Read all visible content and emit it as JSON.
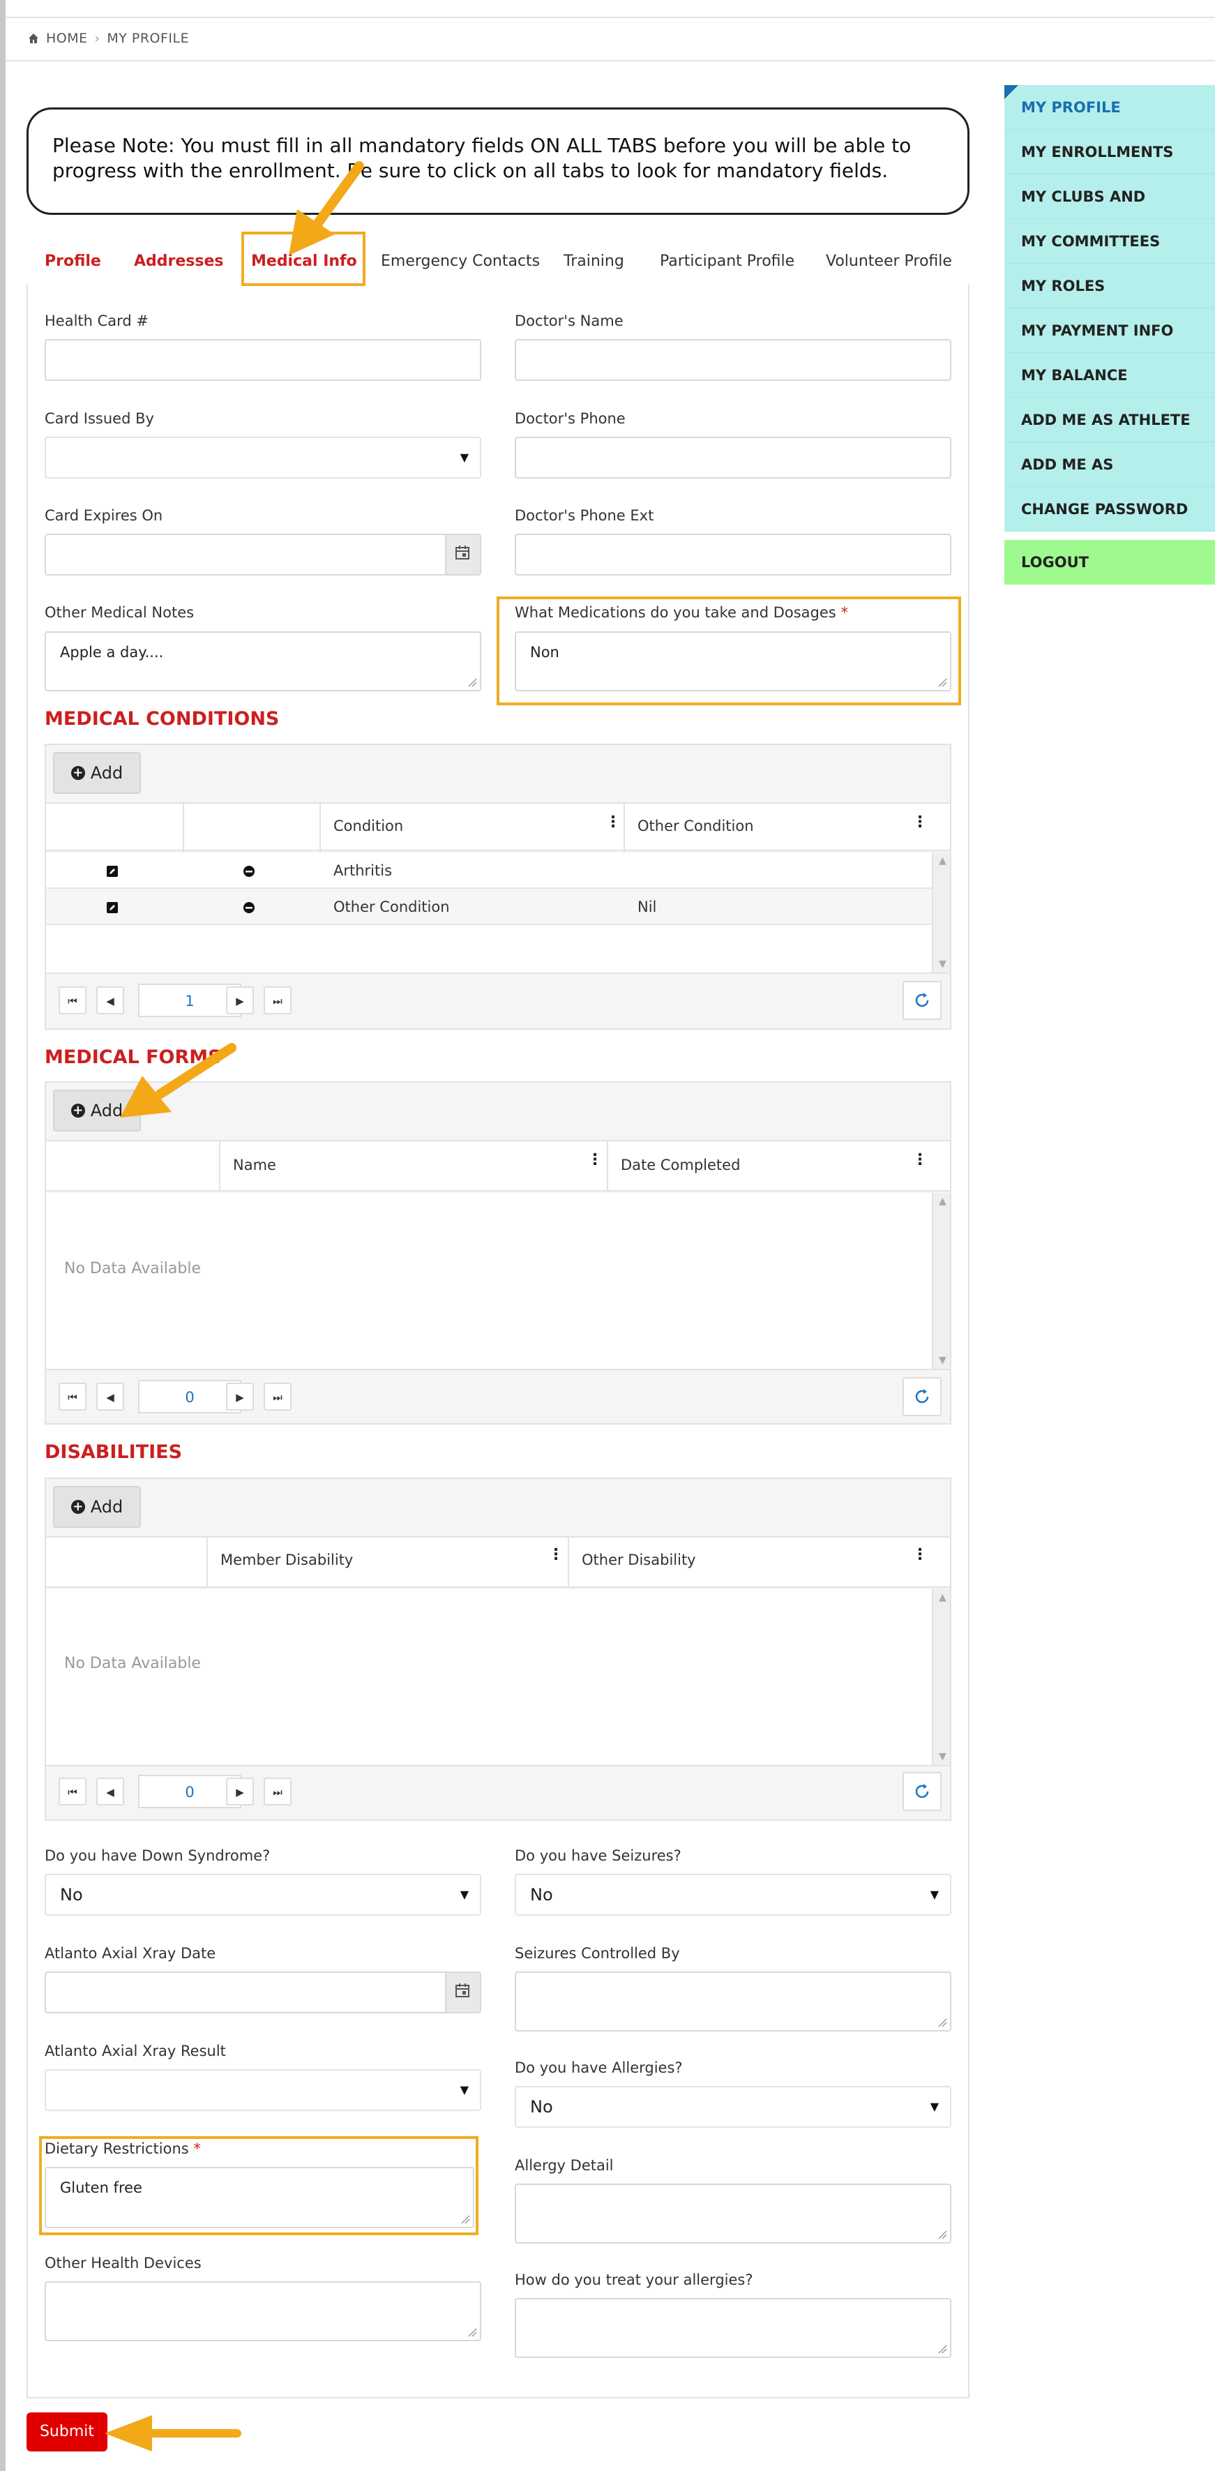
{
  "breadcrumb": {
    "home": "HOME",
    "current": "MY PROFILE"
  },
  "note": "Please Note: You must fill in all mandatory fields ON ALL TABS before you will be able to progress with the enrollment. Be sure to click on all tabs to look for mandatory fields.",
  "tabs": [
    {
      "label": "Profile",
      "required": true
    },
    {
      "label": "Addresses",
      "required": true
    },
    {
      "label": "Medical Info",
      "required": true,
      "active": true
    },
    {
      "label": "Emergency Contacts",
      "required": false
    },
    {
      "label": "Training",
      "required": false
    },
    {
      "label": "Participant Profile",
      "required": false
    },
    {
      "label": "Volunteer Profile",
      "required": false
    }
  ],
  "form": {
    "health_card": {
      "label": "Health Card #",
      "value": ""
    },
    "doctor_name": {
      "label": "Doctor's Name",
      "value": ""
    },
    "card_issued_by": {
      "label": "Card Issued By",
      "value": ""
    },
    "doctor_phone": {
      "label": "Doctor's Phone",
      "value": ""
    },
    "card_expires": {
      "label": "Card Expires On",
      "value": ""
    },
    "doctor_phone_ext": {
      "label": "Doctor's Phone Ext",
      "value": ""
    },
    "other_medical_notes": {
      "label": "Other Medical Notes",
      "value": "Apple a day...."
    },
    "medications": {
      "label": "What Medications do you take and Dosages",
      "required_mark": "*",
      "value": "Non"
    }
  },
  "medical_conditions": {
    "title": "MEDICAL CONDITIONS",
    "add_label": "Add",
    "columns": [
      "Condition",
      "Other Condition"
    ],
    "rows": [
      {
        "condition": "Arthritis",
        "other": ""
      },
      {
        "condition": "Other Condition",
        "other": "Nil"
      }
    ],
    "page": "1"
  },
  "medical_forms": {
    "title": "MEDICAL FORMS",
    "add_label": "Add",
    "columns": [
      "Name",
      "Date Completed"
    ],
    "empty": "No Data Available",
    "page": "0"
  },
  "disabilities": {
    "title": "DISABILITIES",
    "add_label": "Add",
    "columns": [
      "Member Disability",
      "Other Disability"
    ],
    "empty": "No Data Available",
    "page": "0"
  },
  "health": {
    "down_syndrome": {
      "label": "Do you have Down Syndrome?",
      "value": "No"
    },
    "seizures": {
      "label": "Do you have Seizures?",
      "value": "No"
    },
    "atlanto_date": {
      "label": "Atlanto Axial Xray Date",
      "value": ""
    },
    "seizures_controlled": {
      "label": "Seizures Controlled By",
      "value": ""
    },
    "atlanto_result": {
      "label": "Atlanto Axial Xray Result",
      "value": ""
    },
    "allergies": {
      "label": "Do you have Allergies?",
      "value": "No"
    },
    "dietary": {
      "label": "Dietary Restrictions",
      "required_mark": "*",
      "value": "Gluten free"
    },
    "allergy_detail": {
      "label": "Allergy Detail",
      "value": ""
    },
    "other_devices": {
      "label": "Other Health Devices",
      "value": ""
    },
    "treat_allergies": {
      "label": "How do you treat your allergies?",
      "value": ""
    }
  },
  "submit_label": "Submit",
  "sidebar": {
    "items": [
      "MY PROFILE",
      "MY ENROLLMENTS",
      "MY CLUBS AND SCHEDULE",
      "MY COMMITTEES",
      "MY ROLES",
      "MY PAYMENT INFO",
      "MY BALANCE",
      "ADD ME AS ATHLETE",
      "ADD ME AS VOLUNTEER",
      "CHANGE PASSWORD"
    ],
    "logout": "LOGOUT"
  },
  "colors": {
    "required_red": "#cc1f1f",
    "highlight": "#f0ad22",
    "sidebar": "#b5efeb",
    "logout": "#9ef98e",
    "submit": "#e00000"
  }
}
